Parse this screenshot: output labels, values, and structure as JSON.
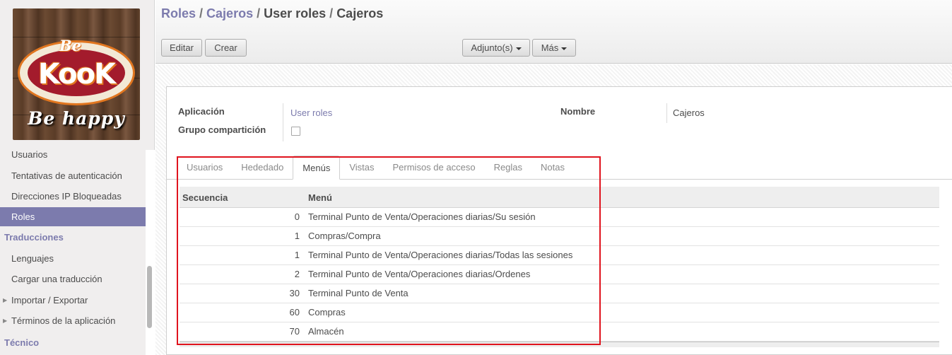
{
  "sidebar": {
    "logo": {
      "line1": "Be",
      "line2": "KooK",
      "line3": "Be happy"
    },
    "items": [
      {
        "label": "Usuarios"
      },
      {
        "label": "Tentativas de autenticación"
      },
      {
        "label": "Direcciones IP Bloqueadas"
      },
      {
        "label": "Roles",
        "active": true
      }
    ],
    "section_translations": "Traducciones",
    "translation_items": [
      {
        "label": "Lenguajes"
      },
      {
        "label": "Cargar una traducción"
      },
      {
        "label": "Importar / Exportar"
      },
      {
        "label": "Términos de la aplicación"
      }
    ],
    "section_technical": "Técnico"
  },
  "breadcrumb": {
    "items": [
      "Roles",
      "Cajeros",
      "User roles",
      "Cajeros"
    ],
    "separator": "/"
  },
  "toolbar": {
    "edit_label": "Editar",
    "create_label": "Crear",
    "attachments_label": "Adjunto(s)",
    "more_label": "Más"
  },
  "form": {
    "application_label": "Aplicación",
    "application_value": "User roles",
    "shared_group_label": "Grupo compartición",
    "shared_group_checked": false,
    "name_label": "Nombre",
    "name_value": "Cajeros"
  },
  "tabs": [
    {
      "label": "Usuarios"
    },
    {
      "label": "Hededado"
    },
    {
      "label": "Menús",
      "active": true
    },
    {
      "label": "Vistas"
    },
    {
      "label": "Permisos de acceso"
    },
    {
      "label": "Reglas"
    },
    {
      "label": "Notas"
    }
  ],
  "menu_table": {
    "headers": {
      "sequence": "Secuencia",
      "menu": "Menú"
    },
    "rows": [
      {
        "sequence": "0",
        "menu": "Terminal Punto de Venta/Operaciones diarias/Su sesión"
      },
      {
        "sequence": "1",
        "menu": "Compras/Compra"
      },
      {
        "sequence": "1",
        "menu": "Terminal Punto de Venta/Operaciones diarias/Todas las sesiones"
      },
      {
        "sequence": "2",
        "menu": "Terminal Punto de Venta/Operaciones diarias/Ordenes"
      },
      {
        "sequence": "30",
        "menu": "Terminal Punto de Venta"
      },
      {
        "sequence": "60",
        "menu": "Compras"
      },
      {
        "sequence": "70",
        "menu": "Almacén"
      }
    ]
  },
  "colors": {
    "accent": "#7c7bad",
    "highlight": "#e0141e"
  }
}
